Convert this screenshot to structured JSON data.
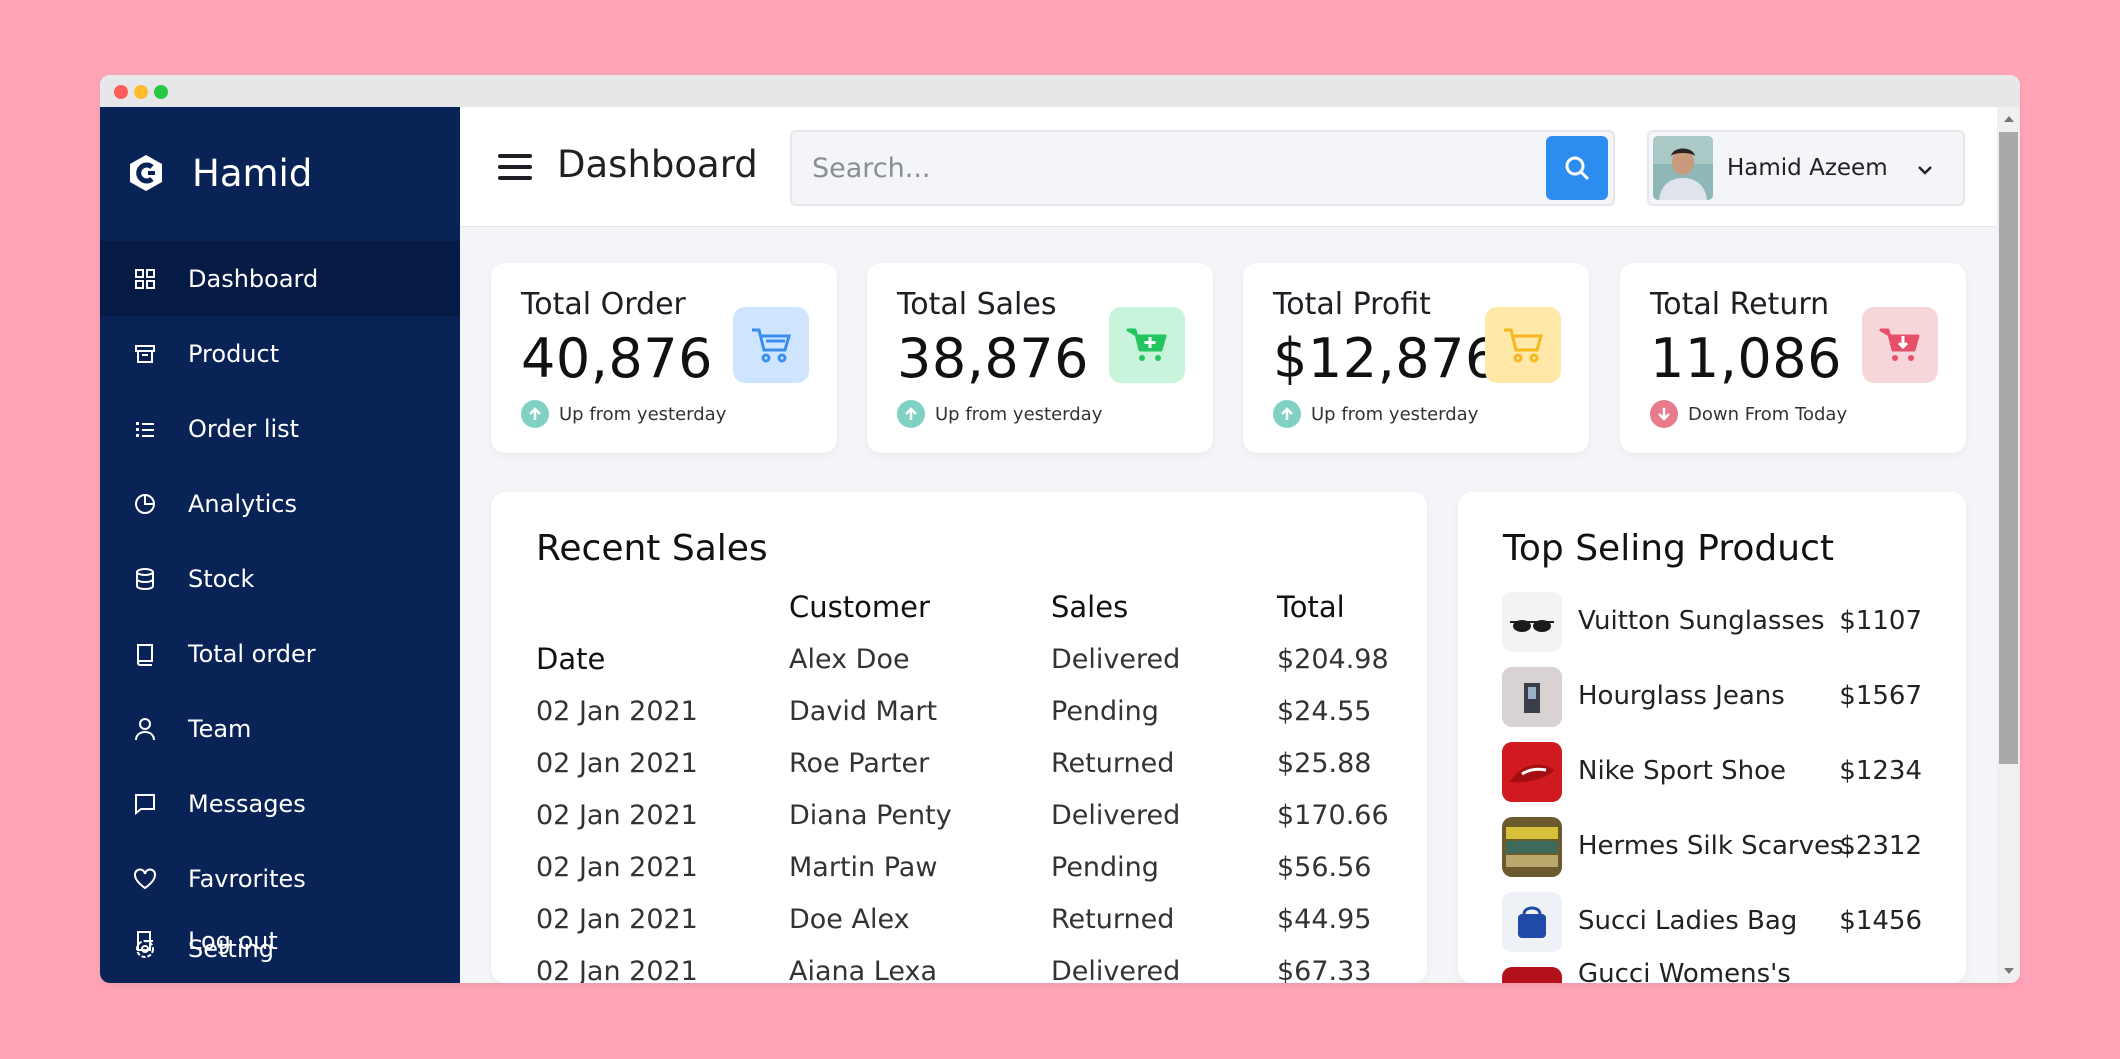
{
  "sidebar": {
    "brand": "Hamid",
    "items": [
      {
        "label": "Dashboard",
        "icon": "grid-icon",
        "active": true
      },
      {
        "label": "Product",
        "icon": "archive-box-icon"
      },
      {
        "label": "Order list",
        "icon": "list-icon"
      },
      {
        "label": "Analytics",
        "icon": "pie-chart-icon"
      },
      {
        "label": "Stock",
        "icon": "database-icon"
      },
      {
        "label": "Total order",
        "icon": "book-icon"
      },
      {
        "label": "Team",
        "icon": "user-icon"
      },
      {
        "label": "Messages",
        "icon": "message-icon"
      },
      {
        "label": "Favrorites",
        "icon": "heart-icon"
      }
    ],
    "overlap": {
      "setting": "Setting",
      "logout": "Log out"
    }
  },
  "header": {
    "title": "Dashboard",
    "search_placeholder": "Search...",
    "user_name": "Hamid Azeem"
  },
  "cards": [
    {
      "title": "Total Order",
      "value": "40,876",
      "note": "Up from yesterday",
      "trend": "up",
      "badge_color": "#cfe5ff",
      "icon_color": "#3a8ef0"
    },
    {
      "title": "Total Sales",
      "value": "38,876",
      "note": "Up from yesterday",
      "trend": "up",
      "badge_color": "#c9f4dc",
      "icon_color": "#22c55e"
    },
    {
      "title": "Total Profit",
      "value": "$12,876",
      "note": "Up from yesterday",
      "trend": "up",
      "badge_color": "#ffe8a8",
      "icon_color": "#f5b91e"
    },
    {
      "title": "Total Return",
      "value": "11,086",
      "note": "Down From Today",
      "trend": "down",
      "badge_color": "#f7d6da",
      "icon_color": "#e5506a"
    }
  ],
  "recent_sales": {
    "title": "Recent Sales",
    "headers": {
      "date": "Date",
      "customer": "Customer",
      "sales": "Sales",
      "total": "Total"
    },
    "rows": [
      {
        "date": "",
        "customer": "Alex Doe",
        "sales": "Delivered",
        "total": "$204.98"
      },
      {
        "date": "02 Jan 2021",
        "customer": "David Mart",
        "sales": "Pending",
        "total": "$24.55"
      },
      {
        "date": "02 Jan 2021",
        "customer": "Roe Parter",
        "sales": "Returned",
        "total": "$25.88"
      },
      {
        "date": "02 Jan 2021",
        "customer": "Diana Penty",
        "sales": "Delivered",
        "total": "$170.66"
      },
      {
        "date": "02 Jan 2021",
        "customer": "Martin Paw",
        "sales": "Pending",
        "total": "$56.56"
      },
      {
        "date": "02 Jan 2021",
        "customer": "Doe Alex",
        "sales": "Returned",
        "total": "$44.95"
      },
      {
        "date": "02 Jan 2021",
        "customer": "Aiana Lexa",
        "sales": "Delivered",
        "total": "$67.33"
      }
    ]
  },
  "top_products": {
    "title": "Top Seling Product",
    "items": [
      {
        "name": "Vuitton Sunglasses",
        "price": "$1107"
      },
      {
        "name": "Hourglass Jeans",
        "price": "$1567"
      },
      {
        "name": "Nike Sport Shoe",
        "price": "$1234"
      },
      {
        "name": "Hermes Silk Scarves.",
        "price": "$2312"
      },
      {
        "name": "Succi Ladies Bag",
        "price": "$1456"
      },
      {
        "name": "Gucci Womens's",
        "price": ""
      }
    ]
  },
  "colors": {
    "sidebar": "#0a2356",
    "accent": "#2d8cf0",
    "trend_up": "#7fd1c3",
    "trend_down": "#e87a8b"
  }
}
